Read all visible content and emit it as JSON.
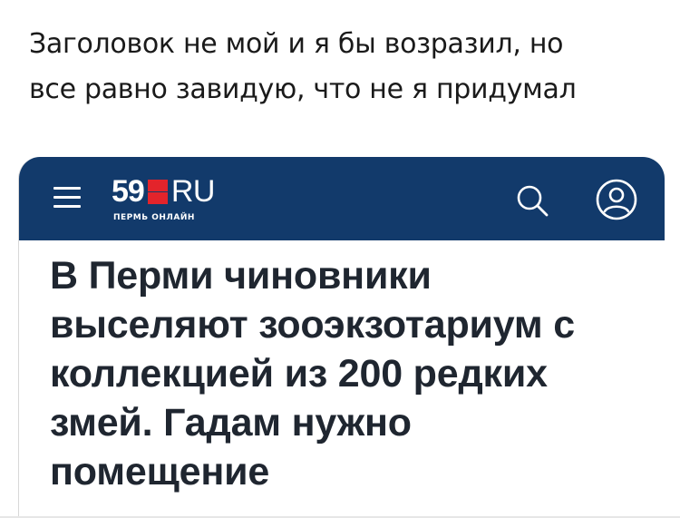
{
  "tweet": {
    "line1": "Заголовок не мой и я бы возразил, но",
    "line2": "все равно завидую, что не я придумал"
  },
  "site": {
    "logo_number": "59",
    "logo_suffix": "RU",
    "logo_tagline": "ПЕРМЬ ОНЛАЙН",
    "header_color": "#123a6b",
    "logo_accent_color": "#e3242b",
    "icons": [
      "menu-icon",
      "search-icon",
      "profile-icon"
    ]
  },
  "article": {
    "headline_lines": [
      "В Перми чиновники",
      "выселяют зооэкзотариум с",
      "коллекцией из 200 редких",
      "змей. Гадам нужно",
      "помещение"
    ]
  }
}
